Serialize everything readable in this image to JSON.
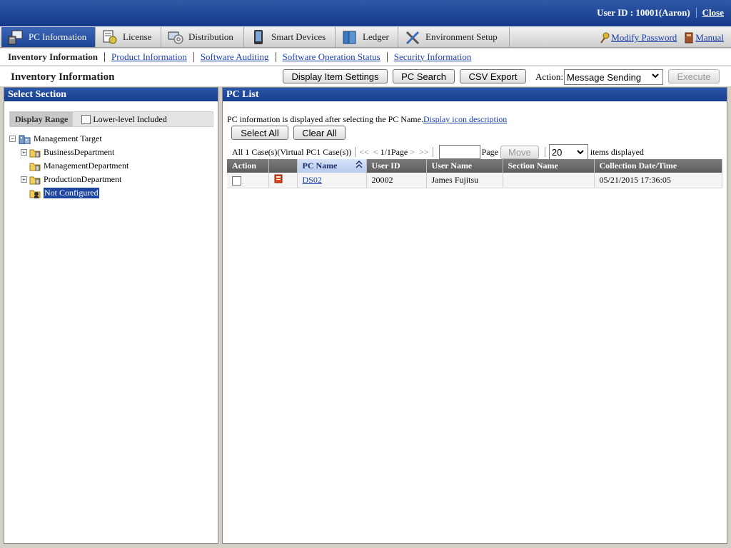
{
  "header": {
    "user_label": "User ID : 10001(Aaron)",
    "close_label": "Close"
  },
  "tabs": [
    {
      "label": "PC Information",
      "icon": "pc-icon"
    },
    {
      "label": "License",
      "icon": "license-icon"
    },
    {
      "label": "Distribution",
      "icon": "distribution-icon"
    },
    {
      "label": "Smart Devices",
      "icon": "smart-device-icon"
    },
    {
      "label": "Ledger",
      "icon": "ledger-icon"
    },
    {
      "label": "Environment Setup",
      "icon": "tools-icon"
    }
  ],
  "top_links": {
    "modify_password": "Modify Password",
    "manual": "Manual"
  },
  "subnav": {
    "current": "Inventory Information",
    "links": [
      "Product Information",
      "Software Auditing",
      "Software Operation Status",
      "Security Information"
    ]
  },
  "toolbar": {
    "page_title": "Inventory Information",
    "display_item_settings": "Display Item Settings",
    "pc_search": "PC Search",
    "csv_export": "CSV Export",
    "action_label": "Action:",
    "action_value": "Message Sending",
    "execute": "Execute"
  },
  "left_panel": {
    "title": "Select Section",
    "display_range": "Display Range",
    "lower_level": "Lower-level Included",
    "tree": {
      "root": "Management Target",
      "children": [
        "BusinessDepartment",
        "ManagementDepartment",
        "ProductionDepartment",
        "Not Configured"
      ]
    }
  },
  "right_panel": {
    "title": "PC List",
    "info_text": "PC information is displayed after selecting the PC Name.",
    "info_link": "Display icon description",
    "select_all": "Select All",
    "clear_all": "Clear All",
    "pager": {
      "count": "All 1 Case(s)(Virtual PC1 Case(s))",
      "first": "<<",
      "prev": "<",
      "current": "1/1Page",
      "next": ">",
      "last": ">>",
      "page_label": "Page",
      "move": "Move",
      "per_page": "20",
      "items_displayed": "items displayed"
    },
    "columns": [
      "Action",
      "",
      "PC Name",
      "User ID",
      "User Name",
      "Section Name",
      "Collection Date/Time"
    ],
    "rows": [
      {
        "pc_name": "DS02",
        "user_id": "20002",
        "user_name": "James Fujitsu",
        "section": "",
        "collected": "05/21/2015 17:36:05"
      }
    ]
  }
}
